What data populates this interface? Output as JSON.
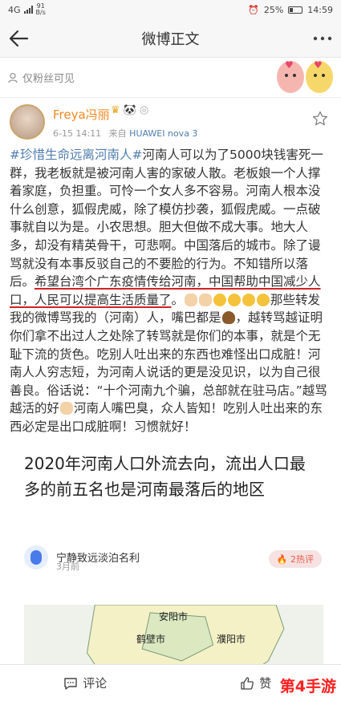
{
  "status": {
    "carrier": "4G",
    "net_speed": "91\nB/s",
    "battery": "25%",
    "time": "14:59"
  },
  "nav": {
    "title": "微博正文"
  },
  "privacy": {
    "label": "仅粉丝可见"
  },
  "post": {
    "user_name": "Freya冯丽",
    "time": "6-15 14:11",
    "source_prefix": "来自",
    "device": "HUAWEI nova 3",
    "hashtag": "#珍惜生命远离河南人#",
    "text_1": "河南人可以为了5000块钱害死一群，我老板就是被河南人害的家破人散。老板娘一个人撑着家庭，负担重。可怜一个女人多不容易。河南人根本没什么创意，狐假虎威，除了模仿抄袭，狐假虎威。一点破事就自以为是。小农思想。胆大但做不成大事。地大人多，却没有精英骨干，可悲啊。中国落后的城市。除了谩骂就没有本事反驳自己的不要脸的行为。不知错所以落后。",
    "text_underlined_1": "希望台湾个广东疫情传给河南，中国帮助中国减少人口，",
    "text_underlined_2": "人民可以提高生活质量了",
    "text_2": "。",
    "text_3": "那些转发我的微博骂我的（河南）人，嘴巴都是",
    "text_4": "，越转骂越证明你们拿不出过人之处除了转骂就是你们的本事，就是个无耻下流的货色。吃别人吐出来的东西也难怪出口成脏！河南人人穷志短，为河南人说话的更是没见识，以为自己很善良。俗话说：“十个河南九个骗，总部就在驻马店。”越骂越活的好",
    "text_5": "河南人嘴巴臭，众人皆知！吃别人吐出来的东西必定是出口成脏啊！习惯就好！"
  },
  "embed": {
    "title": "2020年河南人口外流去向，流出人口最多的前五名也是河南最落后的地区",
    "author": "宁静致远淡泊名利",
    "time": "3月前",
    "hot": "2热评",
    "map_labels": [
      "安阳市",
      "鹤壁市",
      "濮阳市"
    ]
  },
  "bottom": {
    "comment": "评论",
    "like": "赞"
  },
  "watermark": "第4手游",
  "colors": {
    "link": "#507daf",
    "username": "#f28a22",
    "underline": "#d42121"
  }
}
